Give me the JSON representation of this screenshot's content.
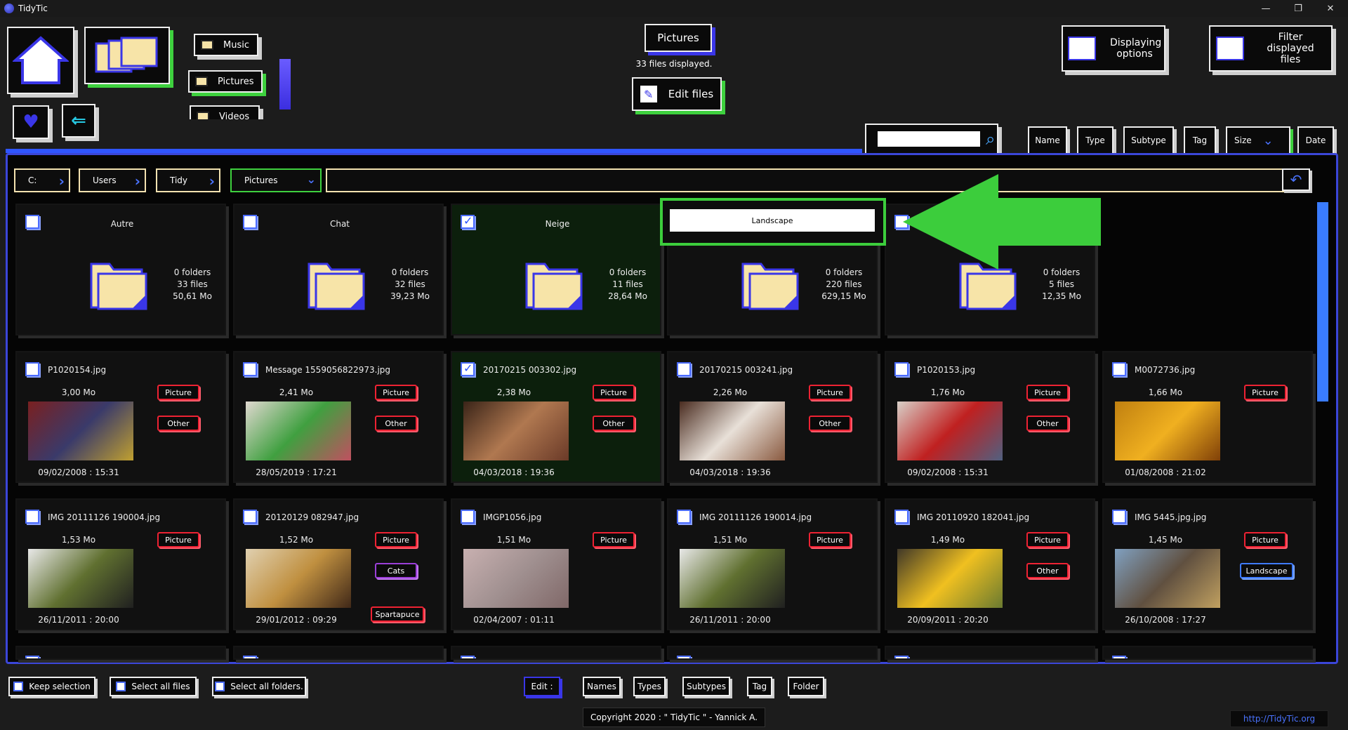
{
  "window": {
    "title": "TidyTic",
    "controls": [
      "—",
      "❐",
      "✕"
    ]
  },
  "nav": {
    "music_label": "Music",
    "pictures_label": "Pictures",
    "videos_label": "Videos"
  },
  "header": {
    "section_title": "Pictures",
    "files_displayed": "33 files displayed.",
    "edit_files_label": "Edit files",
    "display_options_label": "Displaying options",
    "filter_label": "Filter displayed files"
  },
  "search": {
    "value": ""
  },
  "sort": {
    "name": "Name",
    "type": "Type",
    "subtype": "Subtype",
    "tag": "Tag",
    "size": "Size",
    "date": "Date"
  },
  "breadcrumb": [
    "C:",
    "Users",
    "Tidy",
    "Pictures"
  ],
  "rename": {
    "value": "Landscape"
  },
  "folders": [
    {
      "name": "Autre",
      "folders": "0 folders",
      "files": "33 files",
      "size": "50,61 Mo",
      "selected": false
    },
    {
      "name": "Chat",
      "folders": "0 folders",
      "files": "32 files",
      "size": "39,23 Mo",
      "selected": false
    },
    {
      "name": "Neige",
      "folders": "0 folders",
      "files": "11 files",
      "size": "28,64 Mo",
      "selected": true
    },
    {
      "name": "",
      "folders": "0 folders",
      "files": "220 files",
      "size": "629,15 Mo",
      "selected": false
    },
    {
      "name": "",
      "folders": "0 folders",
      "files": "5 files",
      "size": "12,35 Mo",
      "selected": false
    }
  ],
  "files_row1": [
    {
      "name": "P1020154.jpg",
      "size": "3,00 Mo",
      "date": "09/02/2008 : 15:31",
      "tags": [
        "Picture",
        "Other"
      ]
    },
    {
      "name": "Message  1559056822973.jpg",
      "size": "2,41 Mo",
      "date": "28/05/2019 : 17:21",
      "tags": [
        "Picture",
        "Other"
      ]
    },
    {
      "name": "20170215  003302.jpg",
      "size": "2,38 Mo",
      "date": "04/03/2018 : 19:36",
      "tags": [
        "Picture",
        "Other"
      ]
    },
    {
      "name": "20170215  003241.jpg",
      "size": "2,26 Mo",
      "date": "04/03/2018 : 19:36",
      "tags": [
        "Picture",
        "Other"
      ]
    },
    {
      "name": "P1020153.jpg",
      "size": "1,76 Mo",
      "date": "09/02/2008 : 15:31",
      "tags": [
        "Picture",
        "Other"
      ]
    },
    {
      "name": "M0072736.jpg",
      "size": "1,66 Mo",
      "date": "01/08/2008 : 21:02",
      "tags": [
        "Picture"
      ]
    }
  ],
  "files_row2": [
    {
      "name": "IMG  20111126  190004.jpg",
      "size": "1,53 Mo",
      "date": "26/11/2011 : 20:00",
      "tags": [
        "Picture"
      ]
    },
    {
      "name": "20120129  082947.jpg",
      "size": "1,52 Mo",
      "date": "29/01/2012 : 09:29",
      "tags": [
        "Picture",
        "Cats",
        "Spartapuce"
      ]
    },
    {
      "name": "IMGP1056.jpg",
      "size": "1,51 Mo",
      "date": "02/04/2007 : 01:11",
      "tags": [
        "Picture"
      ]
    },
    {
      "name": "IMG  20111126  190014.jpg",
      "size": "1,51 Mo",
      "date": "26/11/2011 : 20:00",
      "tags": [
        "Picture"
      ]
    },
    {
      "name": "IMG  20110920  182041.jpg",
      "size": "1,49 Mo",
      "date": "20/09/2011 : 20:20",
      "tags": [
        "Picture",
        "Other"
      ]
    },
    {
      "name": "IMG  5445.jpg.jpg",
      "size": "1,45 Mo",
      "date": "26/10/2008 : 17:27",
      "tags": [
        "Picture",
        "Landscape"
      ]
    }
  ],
  "bottom": {
    "keep_selection": "Keep selection",
    "select_all_files": "Select all files",
    "select_all_folders": "Select all folders.",
    "edit": "Edit :",
    "names": "Names",
    "types": "Types",
    "subtypes": "Subtypes",
    "tag": "Tag",
    "folder": "Folder"
  },
  "footer": {
    "copyright": "Copyright 2020 : \" TidyTic \" - Yannick A.",
    "link": "http://TidyTic.org"
  },
  "colors": {
    "accent_blue": "#3b46d8",
    "accent_green": "#3ed13e",
    "tag_red": "#e22233",
    "arrow_green": "#3ccd3c"
  }
}
